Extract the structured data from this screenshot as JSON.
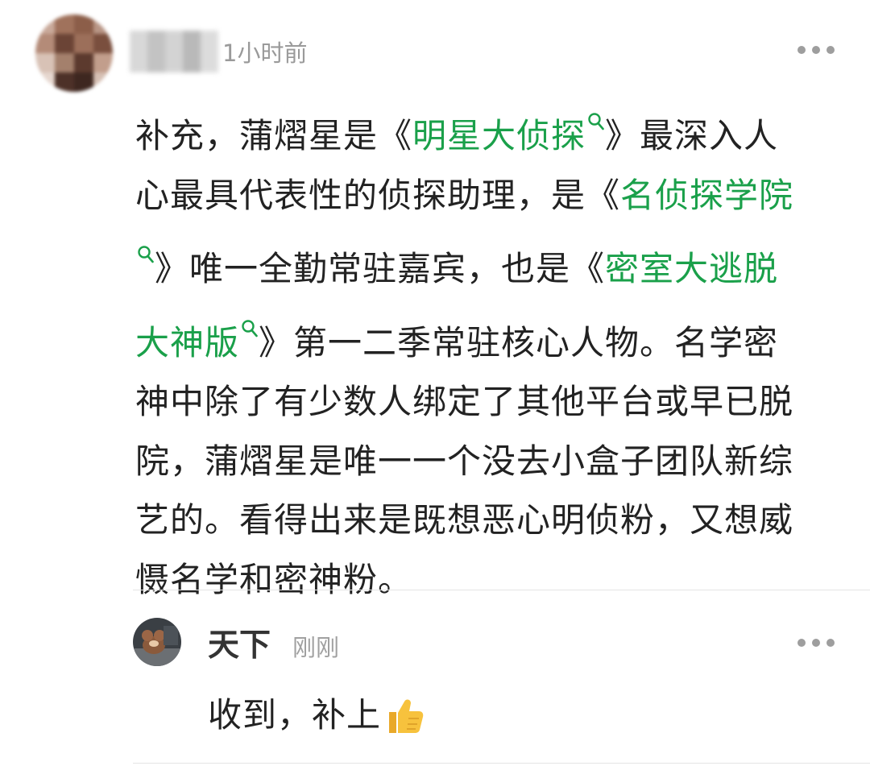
{
  "comment": {
    "author_name": "",
    "time": "1小时前",
    "segments": [
      {
        "text": "补充，蒲熠星是《",
        "link": false
      },
      {
        "text": "明星大侦探",
        "link": true
      },
      {
        "text": "》最深入人心最具代表性的侦探助理，是《",
        "link": false
      },
      {
        "text": "名侦探学院",
        "link": true
      },
      {
        "text": "》唯一全勤常驻嘉宾，也是《",
        "link": false
      },
      {
        "text": "密室大逃脱大神版",
        "link": true
      },
      {
        "text": "》第一二季常驻核心人物。名学密神中除了有少数人绑定了其他平台或早已脱院，蒲熠星是唯一一个没去小盒子团队新综艺的。看得出来是既想恶心明侦粉，又想威慑名学和密神粉。",
        "link": false
      }
    ],
    "lines": [
      [
        {
          "t": "补充，蒲熠星是《",
          "k": false
        },
        {
          "t": "明星大侦探",
          "k": true,
          "icon": true
        },
        {
          "t": "》最深入人",
          "k": false
        }
      ],
      [
        {
          "t": "心最具代表性的侦探助理，是《",
          "k": false
        },
        {
          "t": "名侦探学院",
          "k": true
        }
      ],
      [
        {
          "t": "",
          "k": true,
          "icon": true
        },
        {
          "t": "》唯一全勤常驻嘉宾，也是《",
          "k": false
        },
        {
          "t": "密室大逃脱",
          "k": true
        }
      ],
      [
        {
          "t": "大神版",
          "k": true,
          "icon": true
        },
        {
          "t": "》第一二季常驻核心人物。名学密",
          "k": false
        }
      ],
      [
        {
          "t": "神中除了有少数人绑定了其他平台或早已脱",
          "k": false
        }
      ],
      [
        {
          "t": "院，蒲熠星是唯一一个没去小盒子团队新综",
          "k": false
        }
      ],
      [
        {
          "t": "艺的。看得出来是既想恶心明侦粉，又想威",
          "k": false
        }
      ],
      [
        {
          "t": "慑名学和密神粉。",
          "k": false
        }
      ]
    ],
    "more_icon": "more-dots-icon"
  },
  "reply": {
    "author_name": "天下",
    "time": "刚刚",
    "text": "收到，补上",
    "emoji": "thumbs-up-emoji",
    "more_icon": "more-dots-icon"
  },
  "colors": {
    "link": "#1aa04a",
    "text": "#222222",
    "meta": "#9a9a9a",
    "divider": "#e4e4e4"
  }
}
